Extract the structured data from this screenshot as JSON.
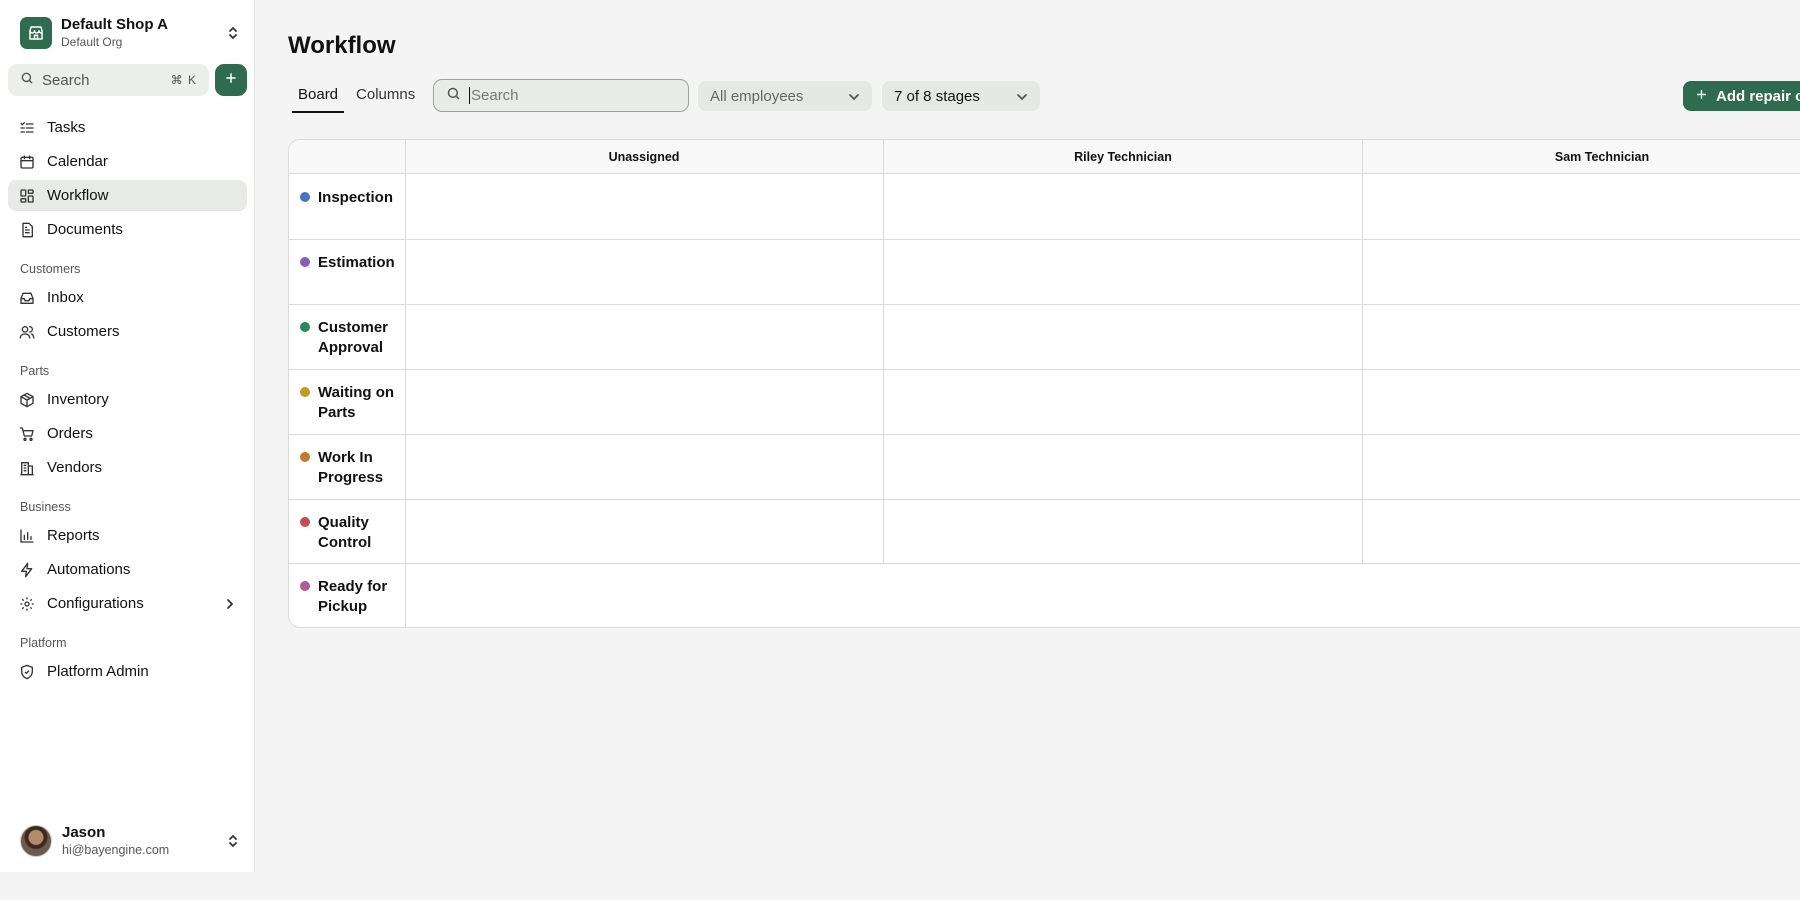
{
  "shop": {
    "name": "Default Shop A",
    "org": "Default Org"
  },
  "search": {
    "label": "Search",
    "shortcut": "⌘ K"
  },
  "nav": {
    "main": [
      {
        "label": "Tasks",
        "icon": "tasks-icon"
      },
      {
        "label": "Calendar",
        "icon": "calendar-icon"
      },
      {
        "label": "Workflow",
        "icon": "workflow-icon",
        "active": true
      },
      {
        "label": "Documents",
        "icon": "documents-icon"
      }
    ],
    "sections": {
      "customers": "Customers",
      "parts": "Parts",
      "business": "Business",
      "platform": "Platform"
    },
    "customers": [
      {
        "label": "Inbox",
        "icon": "inbox-icon"
      },
      {
        "label": "Customers",
        "icon": "users-icon"
      }
    ],
    "parts": [
      {
        "label": "Inventory",
        "icon": "package-icon"
      },
      {
        "label": "Orders",
        "icon": "cart-icon"
      },
      {
        "label": "Vendors",
        "icon": "building-icon"
      }
    ],
    "business": [
      {
        "label": "Reports",
        "icon": "bar-chart-icon"
      },
      {
        "label": "Automations",
        "icon": "zap-icon"
      },
      {
        "label": "Configurations",
        "icon": "gear-icon"
      }
    ],
    "platform": [
      {
        "label": "Platform Admin",
        "icon": "shield-icon"
      }
    ]
  },
  "user": {
    "name": "Jason",
    "email": "hi@bayengine.com"
  },
  "page": {
    "title": "Workflow",
    "tabs": [
      "Board",
      "Columns"
    ],
    "active_tab": "Board",
    "search_placeholder": "Search",
    "employees_filter": "All employees",
    "stages_filter": "7 of 8 stages",
    "add_button": "Add repair order"
  },
  "board": {
    "columns": [
      "Unassigned",
      "Riley Technician",
      "Sam Technician"
    ],
    "stages": [
      {
        "label": "Inspection",
        "color": "#4a72c4"
      },
      {
        "label": "Estimation",
        "color": "#8a5cb8"
      },
      {
        "label": "Customer Approval",
        "color": "#2a8a5a"
      },
      {
        "label": "Waiting on Parts",
        "color": "#c49a22"
      },
      {
        "label": "Work In Progress",
        "color": "#c8772e"
      },
      {
        "label": "Quality Control",
        "color": "#c44e4e"
      },
      {
        "label": "Ready for Pickup",
        "color": "#b25a9a"
      }
    ]
  },
  "colors": {
    "brand": "#2f6b4f",
    "active_nav_bg": "#e8eae8"
  }
}
